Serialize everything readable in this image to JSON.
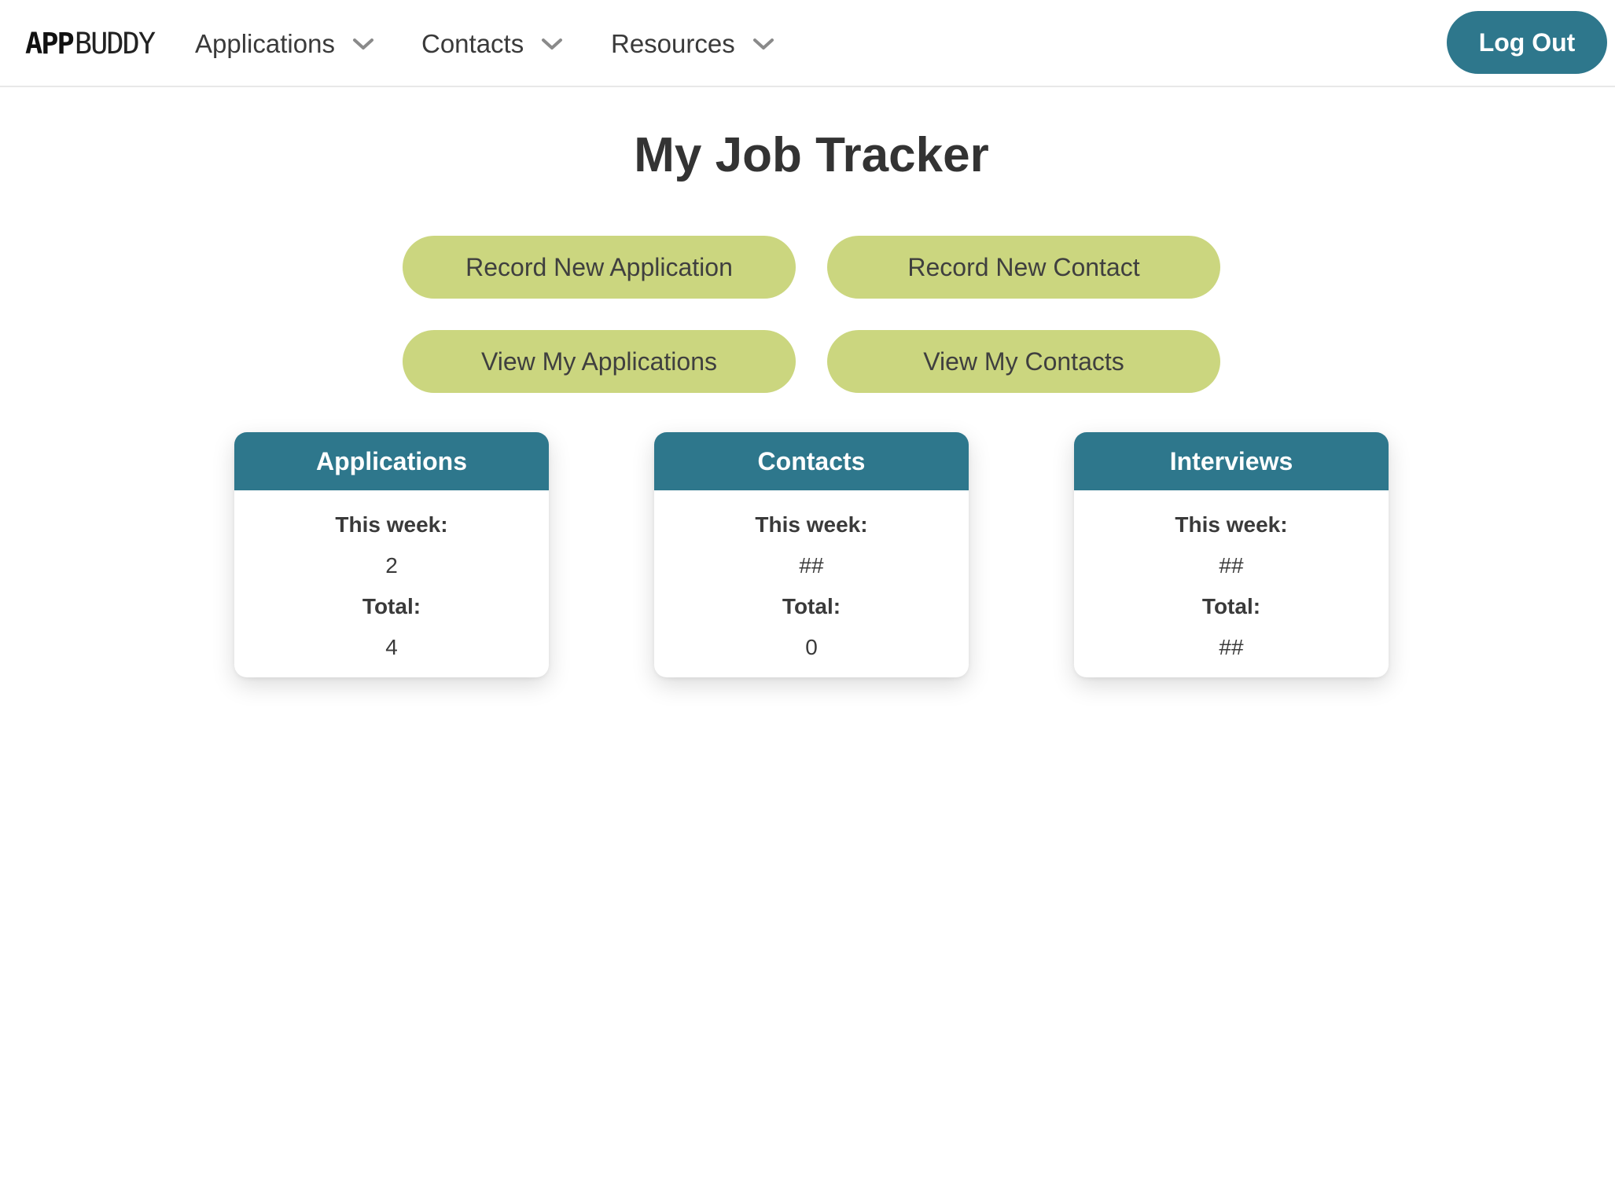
{
  "nav": {
    "logo_bold": "APP",
    "logo_light": "BUDDY",
    "items": [
      {
        "label": "Applications",
        "icon": "chevron-down-icon"
      },
      {
        "label": "Contacts",
        "icon": "chevron-down-icon"
      },
      {
        "label": "Resources",
        "icon": "chevron-down-icon"
      }
    ],
    "logout_label": "Log Out"
  },
  "main": {
    "title": "My Job Tracker",
    "actions": [
      {
        "label": "Record New Application"
      },
      {
        "label": "Record New Contact"
      },
      {
        "label": "View My Applications"
      },
      {
        "label": "View My Contacts"
      }
    ],
    "cards": [
      {
        "title": "Applications",
        "week_label": "This week:",
        "week_value": "2",
        "total_label": "Total:",
        "total_value": "4"
      },
      {
        "title": "Contacts",
        "week_label": "This week:",
        "week_value": "##",
        "total_label": "Total:",
        "total_value": "0"
      },
      {
        "title": "Interviews",
        "week_label": "This week:",
        "week_value": "##",
        "total_label": "Total:",
        "total_value": "##"
      }
    ]
  },
  "colors": {
    "primary": "#2e778c",
    "accent": "#cbd67f",
    "text": "#333333"
  }
}
